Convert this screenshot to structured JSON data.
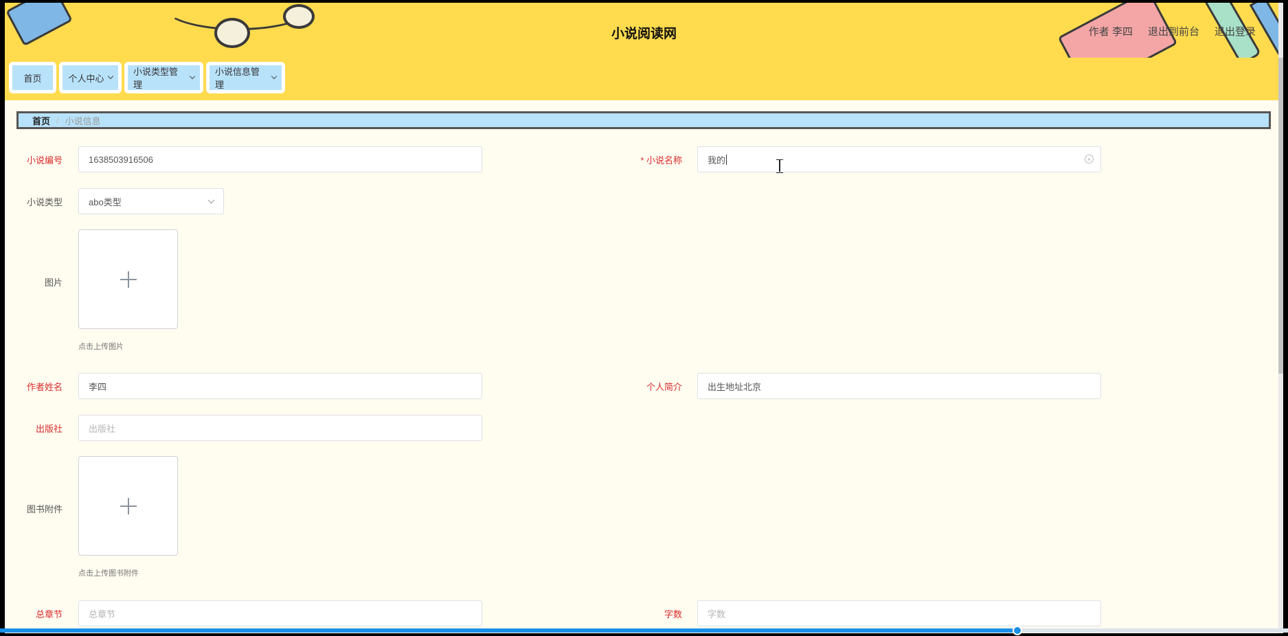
{
  "header": {
    "site_title": "小说阅读网",
    "user_label": "作者 李四",
    "front_link": "退出到前台",
    "logout_link": "退出登录"
  },
  "nav": {
    "home": "首页",
    "personal": "个人中心",
    "type_mgmt": "小说类型管理",
    "info_mgmt": "小说信息管理"
  },
  "breadcrumb": {
    "home": "首页",
    "separator": "/",
    "current": "小说信息"
  },
  "form": {
    "novel_no": {
      "label": "小说编号",
      "value": "1638503916506"
    },
    "novel_name": {
      "label": "* 小说名称",
      "value": "我的"
    },
    "novel_type": {
      "label": "小说类型",
      "value": "abo类型"
    },
    "image": {
      "label": "图片",
      "tip": "点击上传图片"
    },
    "author_name": {
      "label": "作者姓名",
      "value": "李四"
    },
    "profile": {
      "label": "个人简介",
      "value": "出生地址北京"
    },
    "publisher": {
      "label": "出版社",
      "placeholder": "出版社"
    },
    "attachment": {
      "label": "图书附件",
      "tip": "点击上传图书附件"
    },
    "chapters": {
      "label": "总章节",
      "placeholder": "总章节"
    },
    "word_count": {
      "label": "字数",
      "placeholder": "字数"
    }
  },
  "video_progress": 0.79,
  "colors": {
    "header_bg": "#ffdb4d",
    "nav_button_bg": "#b8e2fa",
    "page_bg": "#fffcf0",
    "required_label": "#d92b2b"
  }
}
